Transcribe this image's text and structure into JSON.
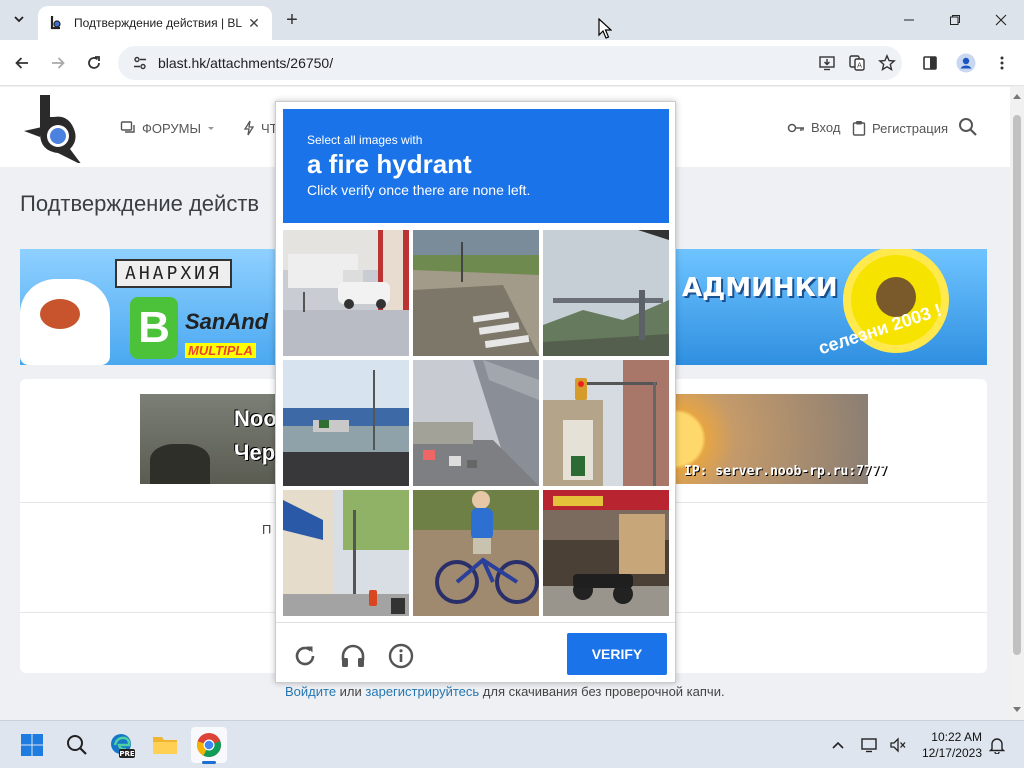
{
  "browser": {
    "tab": {
      "title": "Подтверждение действия | BL"
    },
    "url": "blast.hk/attachments/26750/"
  },
  "site": {
    "nav": {
      "forums": "ФОРУМЫ",
      "chat": "ЧТ",
      "login": "Вход",
      "register": "Регистрация"
    },
    "page_title": "Подтверждение действ",
    "banner_left": {
      "sign": "АНАРХИЯ",
      "letter": "B",
      "text": "SanAnd",
      "sub": "MULTIPLA"
    },
    "banner_right": {
      "text": "АДМИНКИ",
      "arc": "селезни 2003 !"
    },
    "noob_left": {
      "line1": "Noob",
      "line2": "Чере"
    },
    "noob_right": {
      "server": "IP: server.noob-rp.ru:7777"
    },
    "panel_text": "П",
    "footer_line": {
      "login_link": "Войдите",
      "or": " или ",
      "register_link": "зарегистрируйтесь",
      "rest": " для скачивания без проверочной капчи."
    }
  },
  "captcha": {
    "instruction": "Select all images with",
    "object": "a fire hydrant",
    "hint": "Click verify once there are none left.",
    "verify_label": "VERIFY",
    "tiles": [
      {
        "name": "tile-street-truck"
      },
      {
        "name": "tile-crosswalk"
      },
      {
        "name": "tile-bridge-sky"
      },
      {
        "name": "tile-waterfront"
      },
      {
        "name": "tile-overpass-road"
      },
      {
        "name": "tile-traffic-light"
      },
      {
        "name": "tile-storefront-hydrant"
      },
      {
        "name": "tile-boy-bicycle"
      },
      {
        "name": "tile-shop-motorbikes"
      }
    ]
  },
  "taskbar": {
    "time": "10:22 AM",
    "date": "12/17/2023"
  }
}
